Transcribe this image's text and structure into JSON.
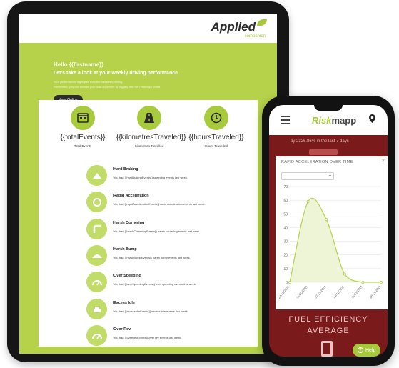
{
  "tablet": {
    "logo": {
      "name": "Applied",
      "sub": "companion"
    },
    "hero": {
      "greeting": "Hello {{firstname}}",
      "subtitle": "Let's take a look at your weekly driving performance",
      "line1": "Your performance highlights from the last week driving.",
      "line2": "Remember, you can access your data anywhere by logging into the Riskmapp portal.",
      "button": "View Online"
    },
    "stats": [
      {
        "icon": "calendar-icon",
        "value": "{{totalEvents}}",
        "label": "Total Events"
      },
      {
        "icon": "road-icon",
        "value": "{{kilometresTraveled}}",
        "label": "Kilometres Travelled"
      },
      {
        "icon": "clock-icon",
        "value": "{{hoursTraveled}}",
        "label": "Hours Travelled"
      }
    ],
    "events": [
      {
        "icon": "brake-icon",
        "title": "Hard Braking",
        "desc": "You had {{hardBrakingEvents}} speeding events last week."
      },
      {
        "icon": "acceleration-icon",
        "title": "Rapid Acceleration",
        "desc": "You had {{rapidAccelerationEvents}} rapid acceleration events last week."
      },
      {
        "icon": "cornering-icon",
        "title": "Harsh Cornering",
        "desc": "You had {{harshCorneringEvents}} harsh cornering events last week."
      },
      {
        "icon": "bump-icon",
        "title": "Harsh Bump",
        "desc": "You had {{harshBumpEvents}} harsh bump events last week."
      },
      {
        "icon": "speed-icon",
        "title": "Over Speeding",
        "desc": "You had {{overSpeedingEvents}} over speeding events this week."
      },
      {
        "icon": "idle-icon",
        "title": "Excess Idle",
        "desc": "You had {{excessIdleEvents}} excess idle events this week."
      },
      {
        "icon": "rev-icon",
        "title": "Over Rev",
        "desc": "You had {{overRevEvents}} over rev events last week."
      }
    ]
  },
  "phone": {
    "brand_left": "Risk",
    "brand_right": "mapp",
    "bg_text": "by 2326.86% in the last 7 days",
    "modal": {
      "title": "RAPID ACCELERATION OVER TIME",
      "close": "×"
    },
    "fuel_line1": "FUEL EFFICIENCY",
    "fuel_line2": "AVERAGE",
    "help": "Help"
  },
  "colors": {
    "accent": "#b5d24a",
    "dark": "#161616",
    "danger_bg": "#7b1a1a"
  },
  "chart_data": {
    "type": "line",
    "title": "RAPID ACCELERATION OVER TIME",
    "x": [
      "24/10/2021",
      "31/10/2021",
      "07/11/2021",
      "14/11/2021",
      "21/11/2021",
      "28/11/2021"
    ],
    "series": [
      {
        "values": [
          0,
          59,
          46,
          6,
          0,
          0
        ]
      }
    ],
    "yticks": [
      0,
      10,
      20,
      30,
      40,
      50,
      60,
      70
    ],
    "ylim": [
      0,
      70
    ],
    "grid": true
  }
}
